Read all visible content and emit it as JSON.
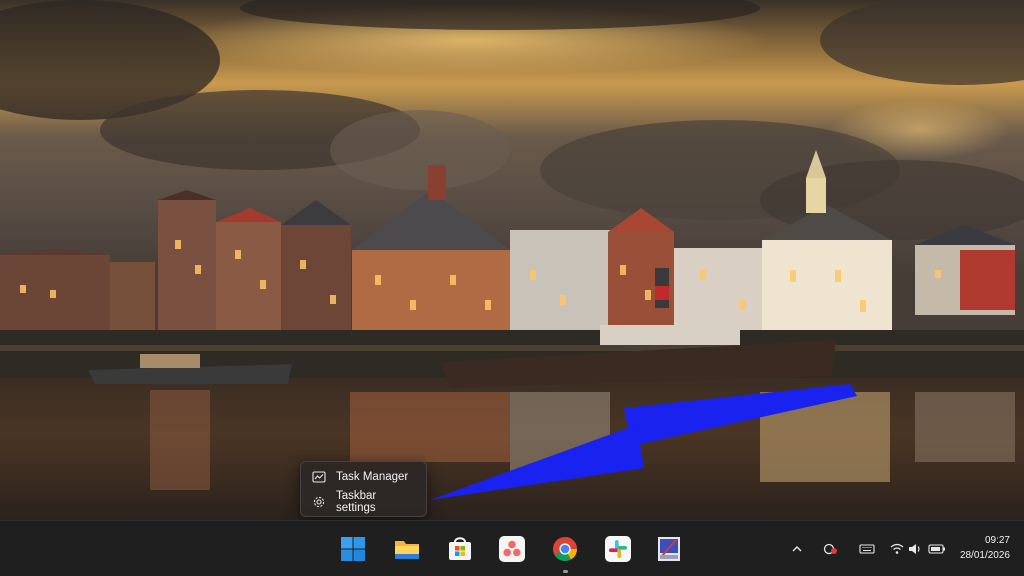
{
  "context_menu": {
    "items": [
      {
        "label": "Task Manager",
        "icon": "task-manager-icon"
      },
      {
        "label": "Taskbar settings",
        "icon": "gear-icon"
      }
    ]
  },
  "annotation": {
    "color": "#1a22f0"
  },
  "taskbar": {
    "apps": [
      {
        "name": "Start",
        "icon": "windows-logo-icon"
      },
      {
        "name": "File Explorer",
        "icon": "folder-icon"
      },
      {
        "name": "Microsoft Store",
        "icon": "store-icon"
      },
      {
        "name": "Asana",
        "icon": "asana-icon"
      },
      {
        "name": "Google Chrome",
        "icon": "chrome-icon"
      },
      {
        "name": "Slack",
        "icon": "slack-icon"
      },
      {
        "name": "Snipping Tool",
        "icon": "snipping-tool-icon"
      }
    ],
    "tray": [
      "chevron-up-icon",
      "app-tray-icon",
      "keyboard-icon",
      "wifi-icon",
      "volume-icon",
      "battery-icon"
    ],
    "clock": {
      "time": "09:27",
      "date": "28/01/2026"
    }
  }
}
